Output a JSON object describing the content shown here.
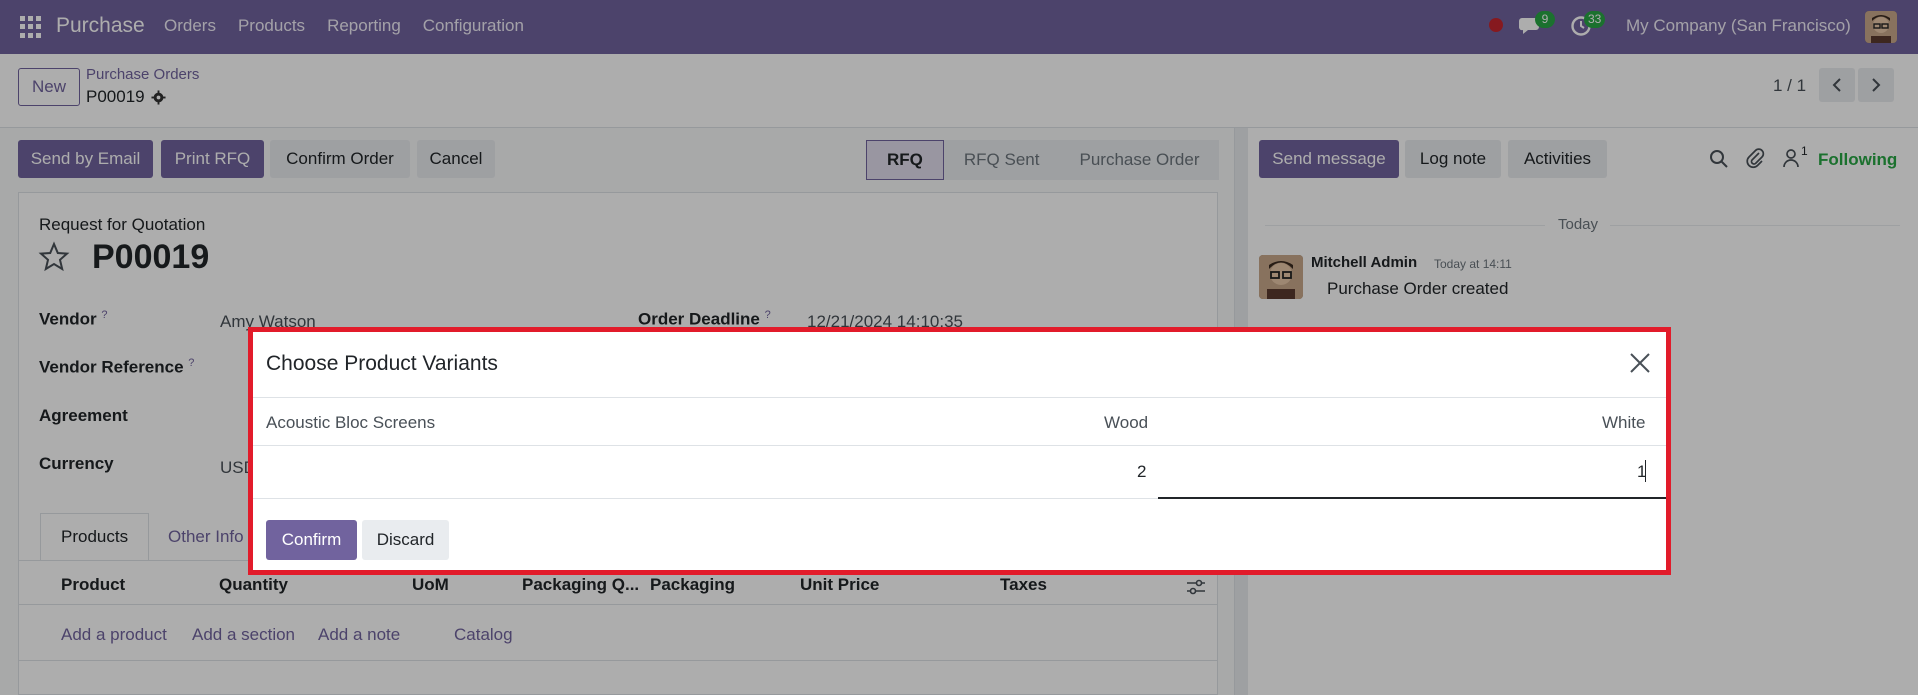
{
  "navbar": {
    "brand": "Purchase",
    "menu": [
      "Orders",
      "Products",
      "Reporting",
      "Configuration"
    ],
    "messages_count": "9",
    "activities_count": "33",
    "company": "My Company (San Francisco)"
  },
  "control": {
    "new_label": "New",
    "breadcrumb": "Purchase Orders",
    "record": "P00019",
    "pager": "1 / 1"
  },
  "actions": {
    "send_email": "Send by Email",
    "print_rfq": "Print RFQ",
    "confirm_order": "Confirm Order",
    "cancel": "Cancel"
  },
  "status": [
    "RFQ",
    "RFQ Sent",
    "Purchase Order"
  ],
  "form": {
    "subtitle": "Request for Quotation",
    "title": "P00019",
    "vendor_label": "Vendor",
    "vendor_value": "Amy Watson",
    "deadline_label": "Order Deadline",
    "deadline_value": "12/21/2024 14:10:35",
    "vendor_ref_label": "Vendor Reference",
    "agreement_label": "Agreement",
    "currency_label": "Currency",
    "currency_value": "USD",
    "help_mark": "?"
  },
  "tabs": [
    "Products",
    "Other Info"
  ],
  "lines": {
    "columns": [
      "Product",
      "Quantity",
      "UoM",
      "Packaging Q...",
      "Packaging",
      "Unit Price",
      "Taxes"
    ],
    "add_product": "Add a product",
    "add_section": "Add a section",
    "add_note": "Add a note",
    "catalog": "Catalog"
  },
  "chatter": {
    "send_message": "Send message",
    "log_note": "Log note",
    "activities": "Activities",
    "follower_count": "1",
    "following": "Following",
    "date_separator": "Today",
    "author": "Mitchell Admin",
    "time": "Today at 14:11",
    "body": "Purchase Order created"
  },
  "modal": {
    "title": "Choose Product Variants",
    "product": "Acoustic Bloc Screens",
    "columns": [
      "Wood",
      "White"
    ],
    "values": [
      "2",
      "1"
    ],
    "confirm": "Confirm",
    "discard": "Discard"
  },
  "colors": {
    "brand": "#71639e",
    "success": "#28a745",
    "highlight": "#e21b2a"
  }
}
